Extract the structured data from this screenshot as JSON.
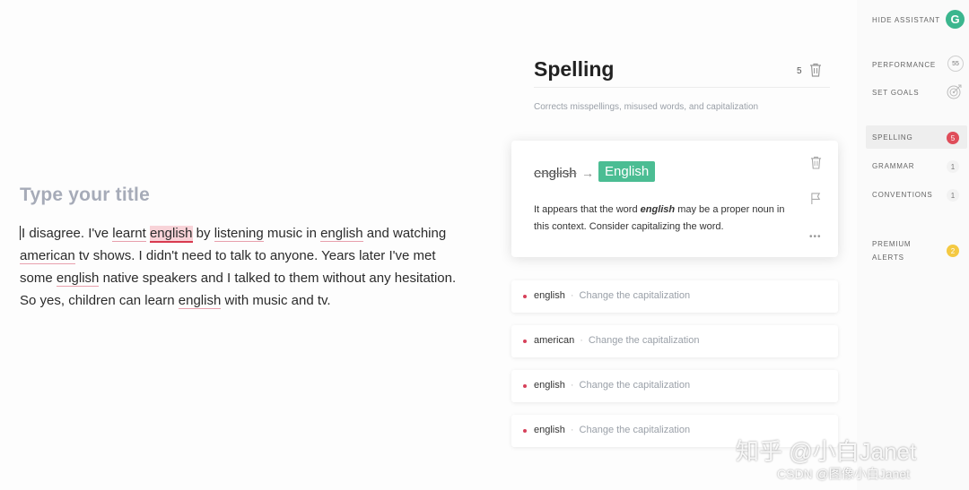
{
  "editor": {
    "title_placeholder": "Type your title",
    "lines": [
      [
        {
          "t": "I disagree. I've ",
          "s": "first"
        },
        {
          "t": "learnt",
          "s": "light"
        },
        {
          "t": " ",
          "s": ""
        },
        {
          "t": "english",
          "s": "active"
        },
        {
          "t": " by ",
          "s": ""
        },
        {
          "t": "listening",
          "s": "light"
        },
        {
          "t": " music in ",
          "s": ""
        },
        {
          "t": "english",
          "s": "light"
        },
        {
          "t": " and watching",
          "s": ""
        }
      ],
      [
        {
          "t": "american",
          "s": "light"
        },
        {
          "t": " tv shows. I didn't need to talk to anyone. Years later I've met",
          "s": ""
        }
      ],
      [
        {
          "t": "some ",
          "s": ""
        },
        {
          "t": "english",
          "s": "light"
        },
        {
          "t": " native speakers and I talked to them without any hesitation.",
          "s": ""
        }
      ],
      [
        {
          "t": "So yes, children can learn ",
          "s": ""
        },
        {
          "t": "english",
          "s": "light"
        },
        {
          "t": " with music and tv.",
          "s": ""
        }
      ]
    ]
  },
  "panel": {
    "title": "Spelling",
    "count": "5",
    "subtitle": "Corrects misspellings, misused words, and capitalization",
    "active_card": {
      "original": "english",
      "arrow": "→",
      "replacement": "English",
      "desc_before": "It appears that the word ",
      "desc_word": "english",
      "desc_after": " may be a proper noun in this context. Consider capitalizing the word.",
      "more": "•••"
    },
    "items": [
      {
        "word": "english",
        "hint": "Change the capitalization"
      },
      {
        "word": "american",
        "hint": "Change the capitalization"
      },
      {
        "word": "english",
        "hint": "Change the capitalization"
      },
      {
        "word": "english",
        "hint": "Change the capitalization"
      }
    ],
    "item_separator": "·"
  },
  "sidebar": {
    "hide_assistant": "HIDE ASSISTANT",
    "logo_letter": "G",
    "performance": "PERFORMANCE",
    "performance_score": "55",
    "set_goals": "SET GOALS",
    "spelling": "SPELLING",
    "spelling_count": "5",
    "grammar": "GRAMMAR",
    "grammar_count": "1",
    "conventions": "CONVENTIONS",
    "conventions_count": "1",
    "premium_line1": "PREMIUM",
    "premium_line2": "ALERTS",
    "premium_count": "2",
    "brand_color": "#3bb68e",
    "alert_color": "#df4d5a"
  },
  "watermark": {
    "text": "知乎 @小白Janet",
    "credit": "CSDN @图像小白Janet"
  }
}
